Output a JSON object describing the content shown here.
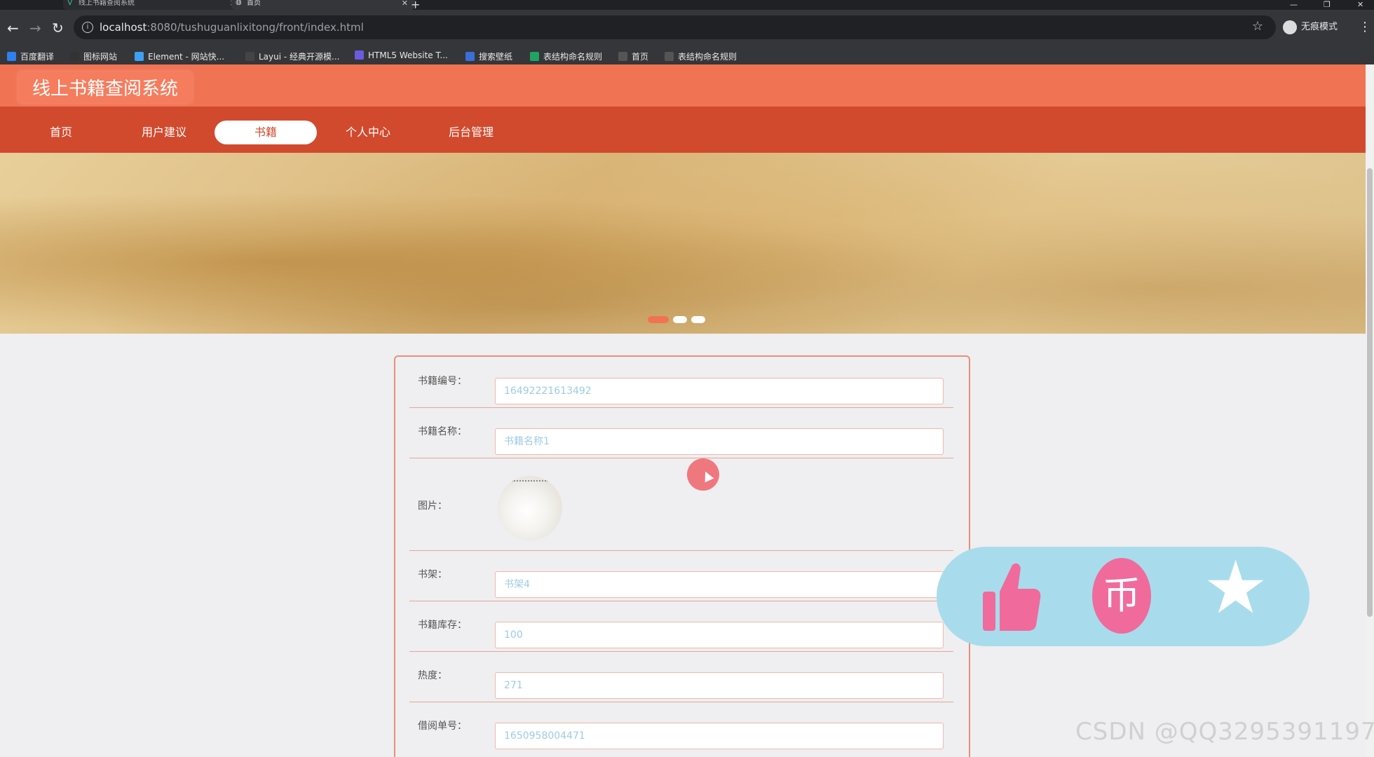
{
  "browser": {
    "tabs": [
      {
        "title": "线上书籍查阅系统"
      },
      {
        "title": "首页"
      }
    ],
    "new_tab": "+",
    "url_host": "localhost",
    "url_rest": ":8080/tushuguanlixitong/front/index.html",
    "incognito_label": "无痕模式",
    "bookmarks": [
      {
        "label": "百度翻译",
        "color": "#2f7ff0"
      },
      {
        "label": "图标网站",
        "color": "#333333"
      },
      {
        "label": "Element - 网站快...",
        "color": "#3ea0f4"
      },
      {
        "label": "Layui - 经典开源模...",
        "color": "#444444"
      },
      {
        "label": "HTML5 Website T...",
        "color": "#6b5be0"
      },
      {
        "label": "搜索壁纸",
        "color": "#3a6fd8"
      },
      {
        "label": "表结构命名规则",
        "color": "#1fa463"
      },
      {
        "label": "首页",
        "color": "#555555"
      },
      {
        "label": "表结构命名规则",
        "color": "#555555"
      }
    ]
  },
  "site": {
    "title": "线上书籍查阅系统",
    "nav": [
      "首页",
      "用户建议",
      "书籍",
      "个人中心",
      "后台管理"
    ],
    "active_nav": "书籍"
  },
  "banner": {
    "slides": 3,
    "active_slide": 1
  },
  "form": {
    "book_no_label": "书籍编号：",
    "book_no_value": "16492221613492",
    "book_name_label": "书籍名称：",
    "book_name_value": "书籍名称1",
    "image_label": "图片：",
    "shelf_label": "书架：",
    "shelf_value": "书架4",
    "stock_label": "书籍库存：",
    "stock_value": "100",
    "hot_label": "热度：",
    "hot_value": "271",
    "borrow_no_label": "借阅单号：",
    "borrow_no_value": "1650958004471"
  },
  "overlay": {
    "coin_glyph": "币",
    "star_glyph": "★"
  },
  "watermark": "CSDN @QQ3295391197",
  "colors": {
    "header": "#f07353",
    "nav": "#d14a2e",
    "accent": "#e5907a",
    "pill": "#a8dcec",
    "coin": "#f06b9b"
  }
}
